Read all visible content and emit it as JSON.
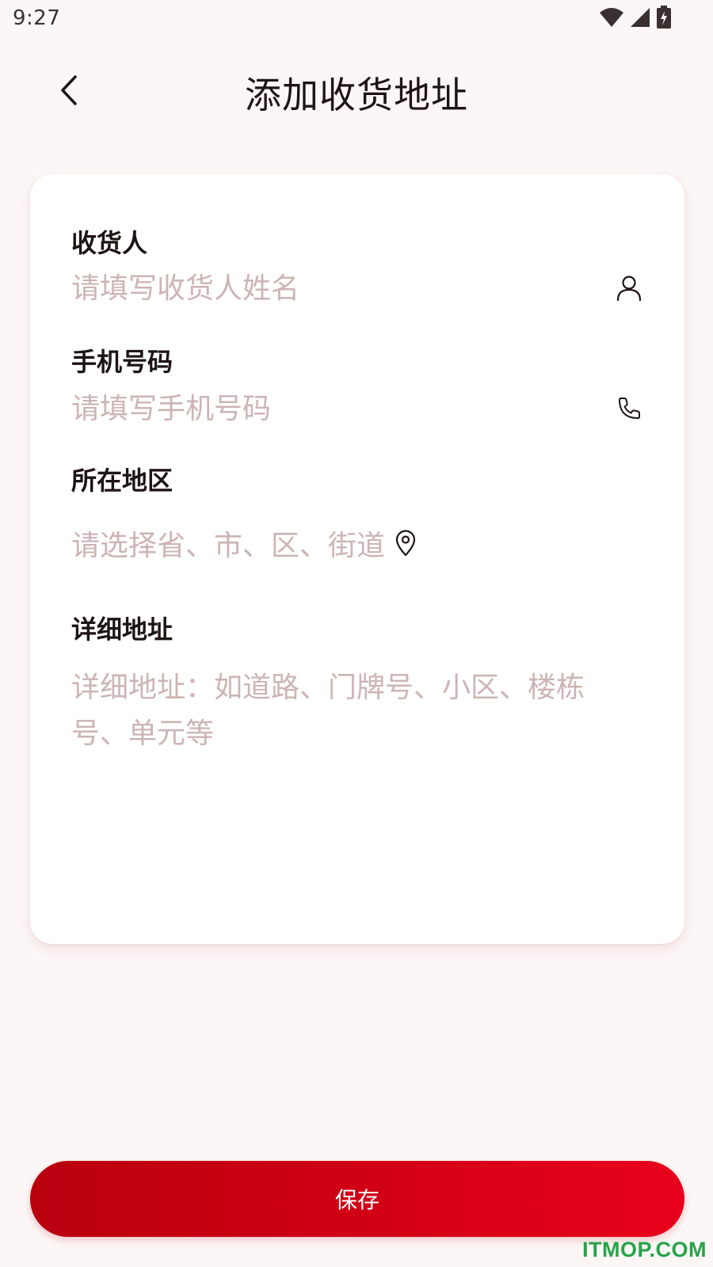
{
  "status_bar": {
    "time": "9:27",
    "icons": [
      "wifi-icon",
      "cellular-signal-icon",
      "battery-charging-icon"
    ]
  },
  "header": {
    "title": "添加收货地址",
    "back_icon": "chevron-left-icon"
  },
  "form": {
    "recipient": {
      "label": "收货人",
      "placeholder": "请填写收货人姓名",
      "icon": "person-icon"
    },
    "phone": {
      "label": "手机号码",
      "placeholder": "请填写手机号码",
      "icon": "phone-icon"
    },
    "region": {
      "label": "所在地区",
      "placeholder": "请选择省、市、区、街道",
      "icon": "location-pin-icon"
    },
    "detail": {
      "label": "详细地址",
      "placeholder": "详细地址：如道路、门牌号、小区、楼栋号、单元等"
    }
  },
  "actions": {
    "save_label": "保存"
  },
  "watermark": "ITMOP.COM",
  "colors": {
    "background": "#fcf7f6",
    "card": "#ffffff",
    "placeholder": "#cdb4b4",
    "primary_start": "#b8000f",
    "primary_end": "#e8001c",
    "watermark": "#27a34a"
  }
}
